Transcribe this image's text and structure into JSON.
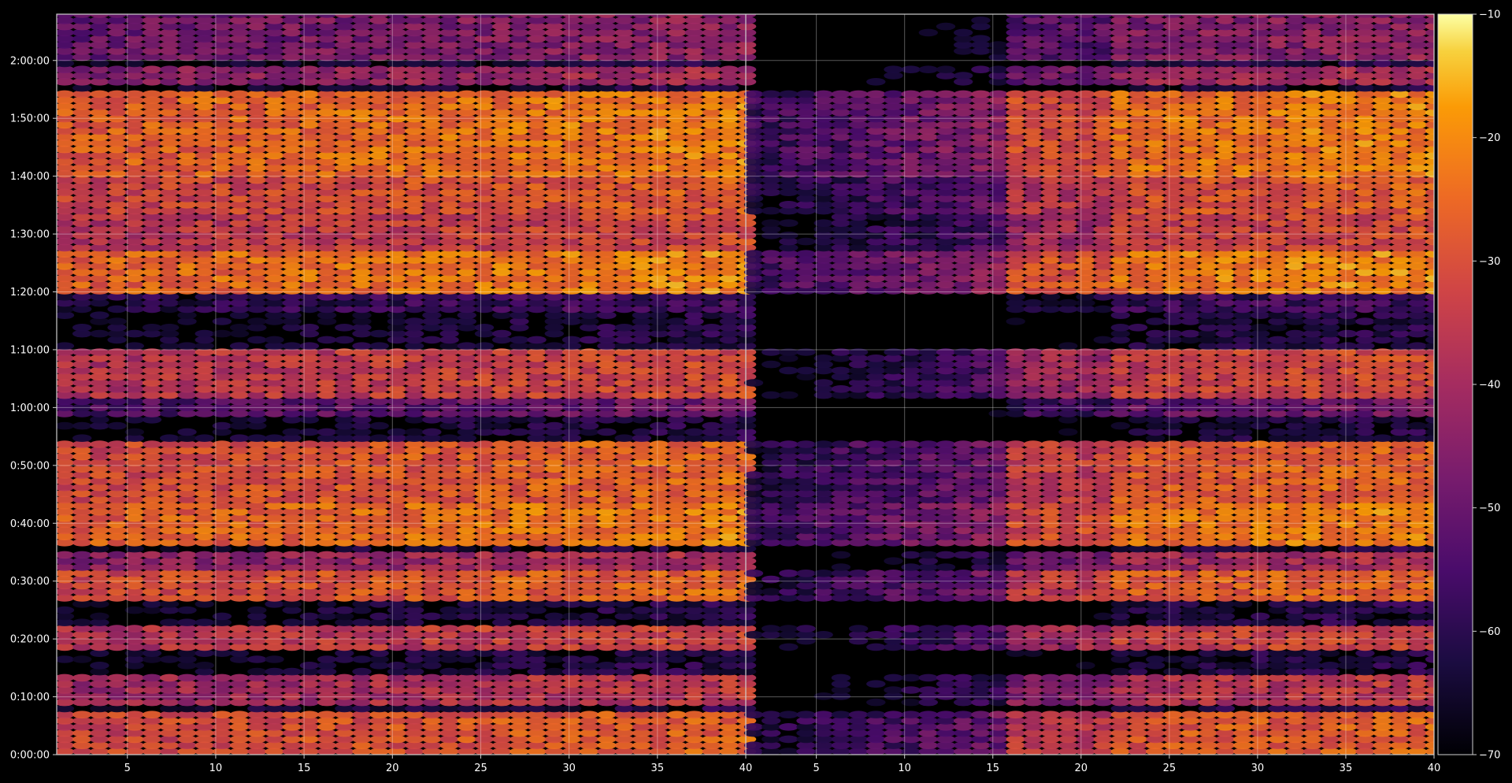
{
  "chart_data": {
    "type": "heatmap",
    "title": "",
    "xlabel": "",
    "ylabel": "",
    "colormap": "inferno",
    "background": "#000000",
    "grid": true,
    "panels": [
      {
        "x_range": [
          1,
          40
        ],
        "xticks": [
          5,
          10,
          15,
          20,
          25,
          30,
          35,
          40
        ],
        "xtick_labels": [
          "5",
          "10",
          "15",
          "20",
          "25",
          "30",
          "35",
          "40"
        ],
        "stronger": true
      },
      {
        "x_range": [
          1,
          40
        ],
        "xticks": [
          5,
          10,
          15,
          20,
          25,
          30,
          35,
          40
        ],
        "xtick_labels": [
          "5",
          "10",
          "15",
          "20",
          "25",
          "30",
          "35",
          "40"
        ],
        "stronger": false
      }
    ],
    "y_range_seconds": [
      0,
      7680
    ],
    "yticks_seconds": [
      0,
      600,
      1200,
      1800,
      2400,
      3000,
      3600,
      4200,
      4800,
      5400,
      6000,
      6600,
      7200
    ],
    "ytick_labels": [
      "0:00:00",
      "0:10:00",
      "0:20:00",
      "0:30:00",
      "0:40:00",
      "0:50:00",
      "1:00:00",
      "1:10:00",
      "1:20:00",
      "1:30:00",
      "1:40:00",
      "1:50:00",
      "2:00:00"
    ],
    "colorbar": {
      "range": [
        -70,
        -10
      ],
      "ticks": [
        -70,
        -60,
        -50,
        -40,
        -30,
        -20,
        -10
      ],
      "tick_labels": [
        "−70",
        "−60",
        "−50",
        "−40",
        "−30",
        "−20",
        "−10"
      ]
    },
    "bands": [
      {
        "t_start": 0,
        "t_end": 420,
        "level": -33
      },
      {
        "t_start": 480,
        "t_end": 840,
        "level": -42
      },
      {
        "t_start": 1080,
        "t_end": 1320,
        "level": -38
      },
      {
        "t_start": 1620,
        "t_end": 1920,
        "level": -32
      },
      {
        "t_start": 1920,
        "t_end": 2100,
        "level": -45
      },
      {
        "t_start": 2160,
        "t_end": 2640,
        "level": -28
      },
      {
        "t_start": 2640,
        "t_end": 3240,
        "level": -32
      },
      {
        "t_start": 3480,
        "t_end": 3720,
        "level": -55
      },
      {
        "t_start": 3720,
        "t_end": 4200,
        "level": -38
      },
      {
        "t_start": 4620,
        "t_end": 4800,
        "level": -62
      },
      {
        "t_start": 4800,
        "t_end": 5220,
        "level": -27
      },
      {
        "t_start": 5220,
        "t_end": 5640,
        "level": -38
      },
      {
        "t_start": 5640,
        "t_end": 6000,
        "level": -34
      },
      {
        "t_start": 6000,
        "t_end": 6900,
        "level": -28
      },
      {
        "t_start": 6960,
        "t_end": 7140,
        "level": -46
      },
      {
        "t_start": 7200,
        "t_end": 7680,
        "level": -50
      }
    ]
  }
}
